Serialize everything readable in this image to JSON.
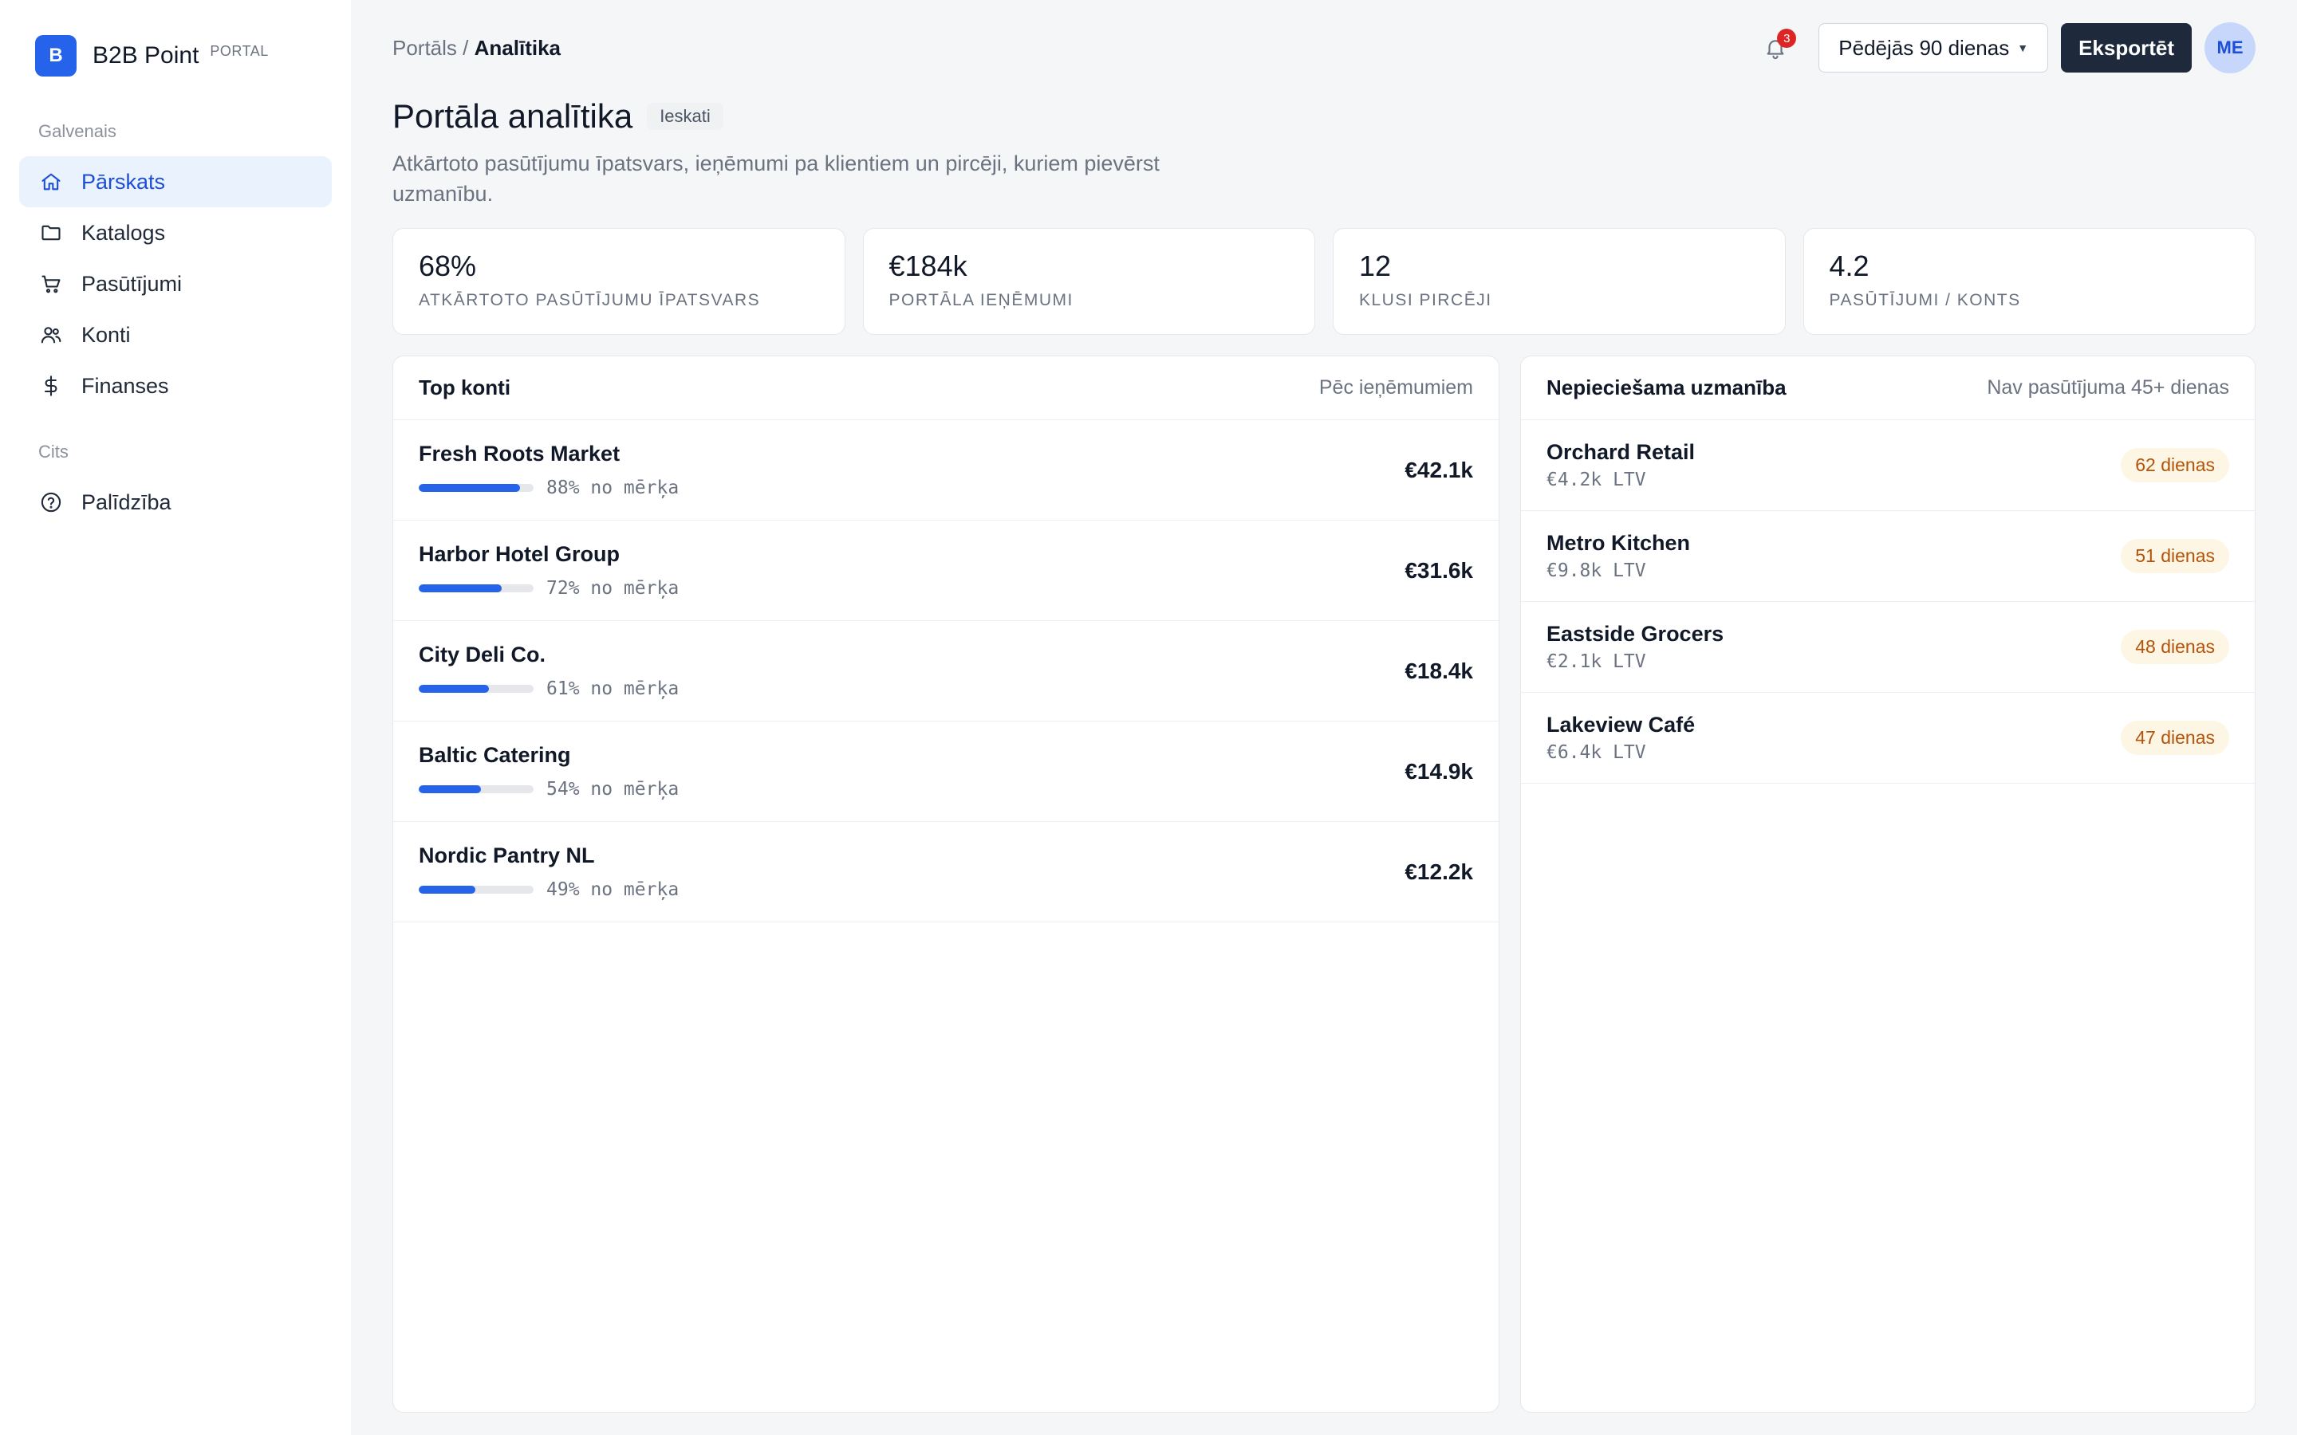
{
  "brand": {
    "logo_letter": "B",
    "name": "B2B Point",
    "tag": "PORTAL"
  },
  "sidebar": {
    "section_main": "Galvenais",
    "section_other": "Cits",
    "items": [
      {
        "label": "Pārskats",
        "icon": "home-icon",
        "active": true
      },
      {
        "label": "Katalogs",
        "icon": "folder-icon"
      },
      {
        "label": "Pasūtījumi",
        "icon": "cart-icon"
      },
      {
        "label": "Konti",
        "icon": "users-icon"
      },
      {
        "label": "Finanses",
        "icon": "dollar-icon"
      }
    ],
    "help": {
      "label": "Palīdzība",
      "icon": "help-circle-icon"
    }
  },
  "topbar": {
    "breadcrumb_parent": "Portāls",
    "breadcrumb_sep": "/",
    "breadcrumb_current": "Analītika",
    "notifications_count": "3",
    "range_label": "Pēdējās 90 dienas",
    "export_label": "Eksportēt",
    "avatar_initials": "ME"
  },
  "page": {
    "title": "Portāla analītika",
    "badge": "Ieskati",
    "subtitle": "Atkārtoto pasūtījumu īpatsvars, ieņēmumi pa klientiem un pircēji, kuriem pievērst uzmanību."
  },
  "stats": [
    {
      "value": "68%",
      "label": "Atkārtoto pasūtījumu īpatsvars"
    },
    {
      "value": "€184k",
      "label": "Portāla ieņēmumi"
    },
    {
      "value": "12",
      "label": "Klusi pircēji"
    },
    {
      "value": "4.2",
      "label": "Pasūtījumi / konts"
    }
  ],
  "top_accounts": {
    "title": "Top konti",
    "meta": "Pēc ieņēmumiem",
    "rows": [
      {
        "name": "Fresh Roots Market",
        "progress": 88,
        "progress_label": "88% no mērķa",
        "value": "€42.1k"
      },
      {
        "name": "Harbor Hotel Group",
        "progress": 72,
        "progress_label": "72% no mērķa",
        "value": "€31.6k"
      },
      {
        "name": "City Deli Co.",
        "progress": 61,
        "progress_label": "61% no mērķa",
        "value": "€18.4k"
      },
      {
        "name": "Baltic Catering",
        "progress": 54,
        "progress_label": "54% no mērķa",
        "value": "€14.9k"
      },
      {
        "name": "Nordic Pantry NL",
        "progress": 49,
        "progress_label": "49% no mērķa",
        "value": "€12.2k"
      }
    ]
  },
  "attention": {
    "title": "Nepieciešama uzmanība",
    "meta": "Nav pasūtījuma 45+ dienas",
    "rows": [
      {
        "name": "Orchard Retail",
        "ltv": "€4.2k LTV",
        "days": "62 dienas"
      },
      {
        "name": "Metro Kitchen",
        "ltv": "€9.8k LTV",
        "days": "51 dienas"
      },
      {
        "name": "Eastside Grocers",
        "ltv": "€2.1k LTV",
        "days": "48 dienas"
      },
      {
        "name": "Lakeview Café",
        "ltv": "€6.4k LTV",
        "days": "47 dienas"
      }
    ]
  },
  "colors": {
    "accent": "#2563eb",
    "dark_button": "#1e293b",
    "warning_text": "#b45309",
    "warning_bg": "#fef6e4"
  }
}
